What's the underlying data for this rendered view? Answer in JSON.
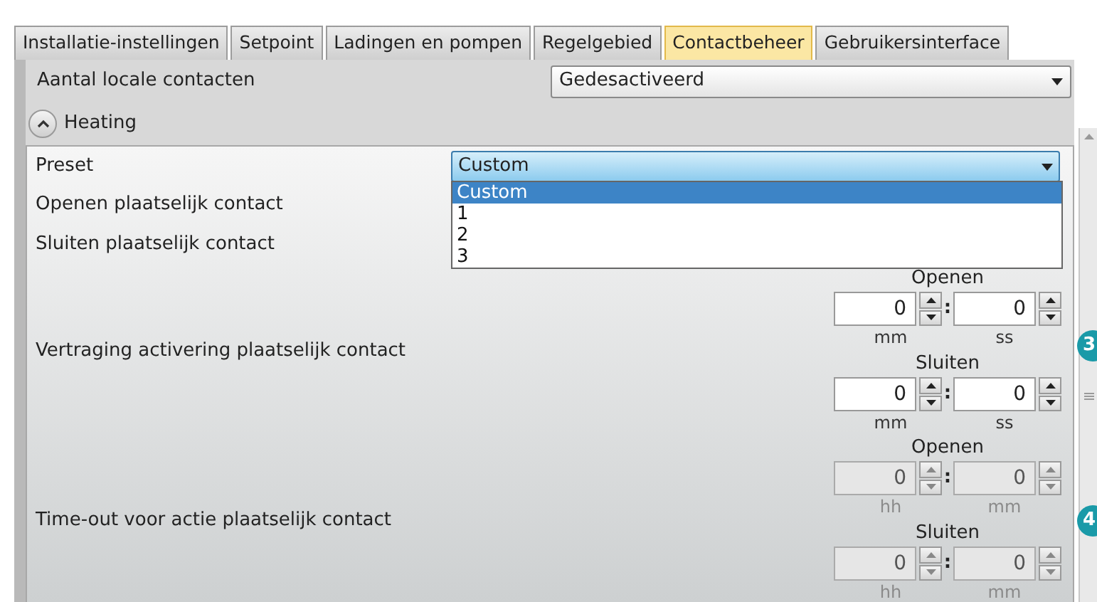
{
  "tabs": [
    {
      "label": "Installatie-instellingen",
      "selected": false
    },
    {
      "label": "Setpoint",
      "selected": false
    },
    {
      "label": "Ladingen en pompen",
      "selected": false
    },
    {
      "label": "Regelgebied",
      "selected": false
    },
    {
      "label": "Contactbeheer",
      "selected": true
    },
    {
      "label": "Gebruikersinterface",
      "selected": false
    }
  ],
  "local_contacts": {
    "label": "Aantal locale contacten",
    "value": "Gedesactiveerd"
  },
  "heating": {
    "title": "Heating",
    "expanded": true,
    "preset": {
      "label": "Preset",
      "value": "Custom",
      "open": true,
      "options": [
        {
          "label": "Custom",
          "selected": true
        },
        {
          "label": "1",
          "selected": false
        },
        {
          "label": "2",
          "selected": false
        },
        {
          "label": "3",
          "selected": false
        }
      ]
    },
    "rows": [
      "Openen plaatselijk contact",
      "Sluiten plaatselijk contact"
    ],
    "timers": [
      {
        "label": "Vertraging activering plaatselijk contact",
        "groups": [
          {
            "title": "Openen",
            "disabled": false,
            "separator": ":",
            "fields": [
              {
                "value": "0",
                "unit": "mm"
              },
              {
                "value": "0",
                "unit": "ss"
              }
            ]
          },
          {
            "title": "Sluiten",
            "disabled": false,
            "separator": ":",
            "fields": [
              {
                "value": "0",
                "unit": "mm"
              },
              {
                "value": "0",
                "unit": "ss"
              }
            ]
          }
        ]
      },
      {
        "label": "Time-out voor actie plaatselijk contact",
        "groups": [
          {
            "title": "Openen",
            "disabled": true,
            "separator": ":",
            "fields": [
              {
                "value": "0",
                "unit": "hh"
              },
              {
                "value": "0",
                "unit": "mm"
              }
            ]
          },
          {
            "title": "Sluiten",
            "disabled": true,
            "separator": ":",
            "fields": [
              {
                "value": "0",
                "unit": "hh"
              },
              {
                "value": "0",
                "unit": "mm"
              }
            ]
          }
        ]
      }
    ]
  },
  "callouts": [
    "3",
    "4"
  ]
}
